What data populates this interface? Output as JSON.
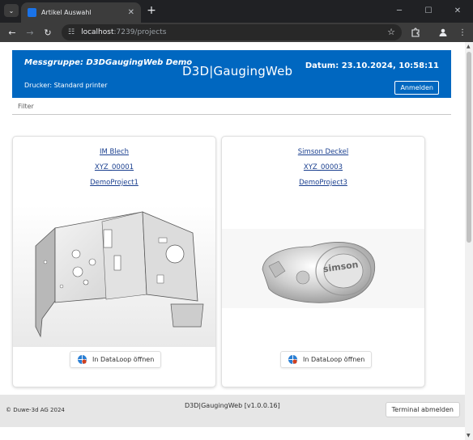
{
  "browser": {
    "tab_title": "Artikel Auswahl",
    "tab_close": "✕",
    "new_tab": "+",
    "url_host": "localhost",
    "url_path": ":7239/projects"
  },
  "header": {
    "group": "Messgruppe: D3DGaugingWeb Demo",
    "printer": "Drucker: Standard printer",
    "brand": "D3D|GaugingWeb",
    "date": "Datum: 23.10.2024, 10:58:11",
    "login_label": "Anmelden",
    "accent": "#0067c0"
  },
  "filter": {
    "label": "Filter"
  },
  "cards": [
    {
      "name": "IM Blech",
      "id": "XYZ_00001",
      "project": "DemoProject1",
      "button": "In DataLoop öffnen"
    },
    {
      "name": "Simson Deckel",
      "id": "XYZ_00003",
      "project": "DemoProject3",
      "button": "In DataLoop öffnen"
    }
  ],
  "footer": {
    "copyright": "© Duwe-3d AG 2024",
    "version": "D3D|GaugingWeb [v1.0.0.16]",
    "logout_label": "Terminal abmelden"
  },
  "cover_text": "simson"
}
